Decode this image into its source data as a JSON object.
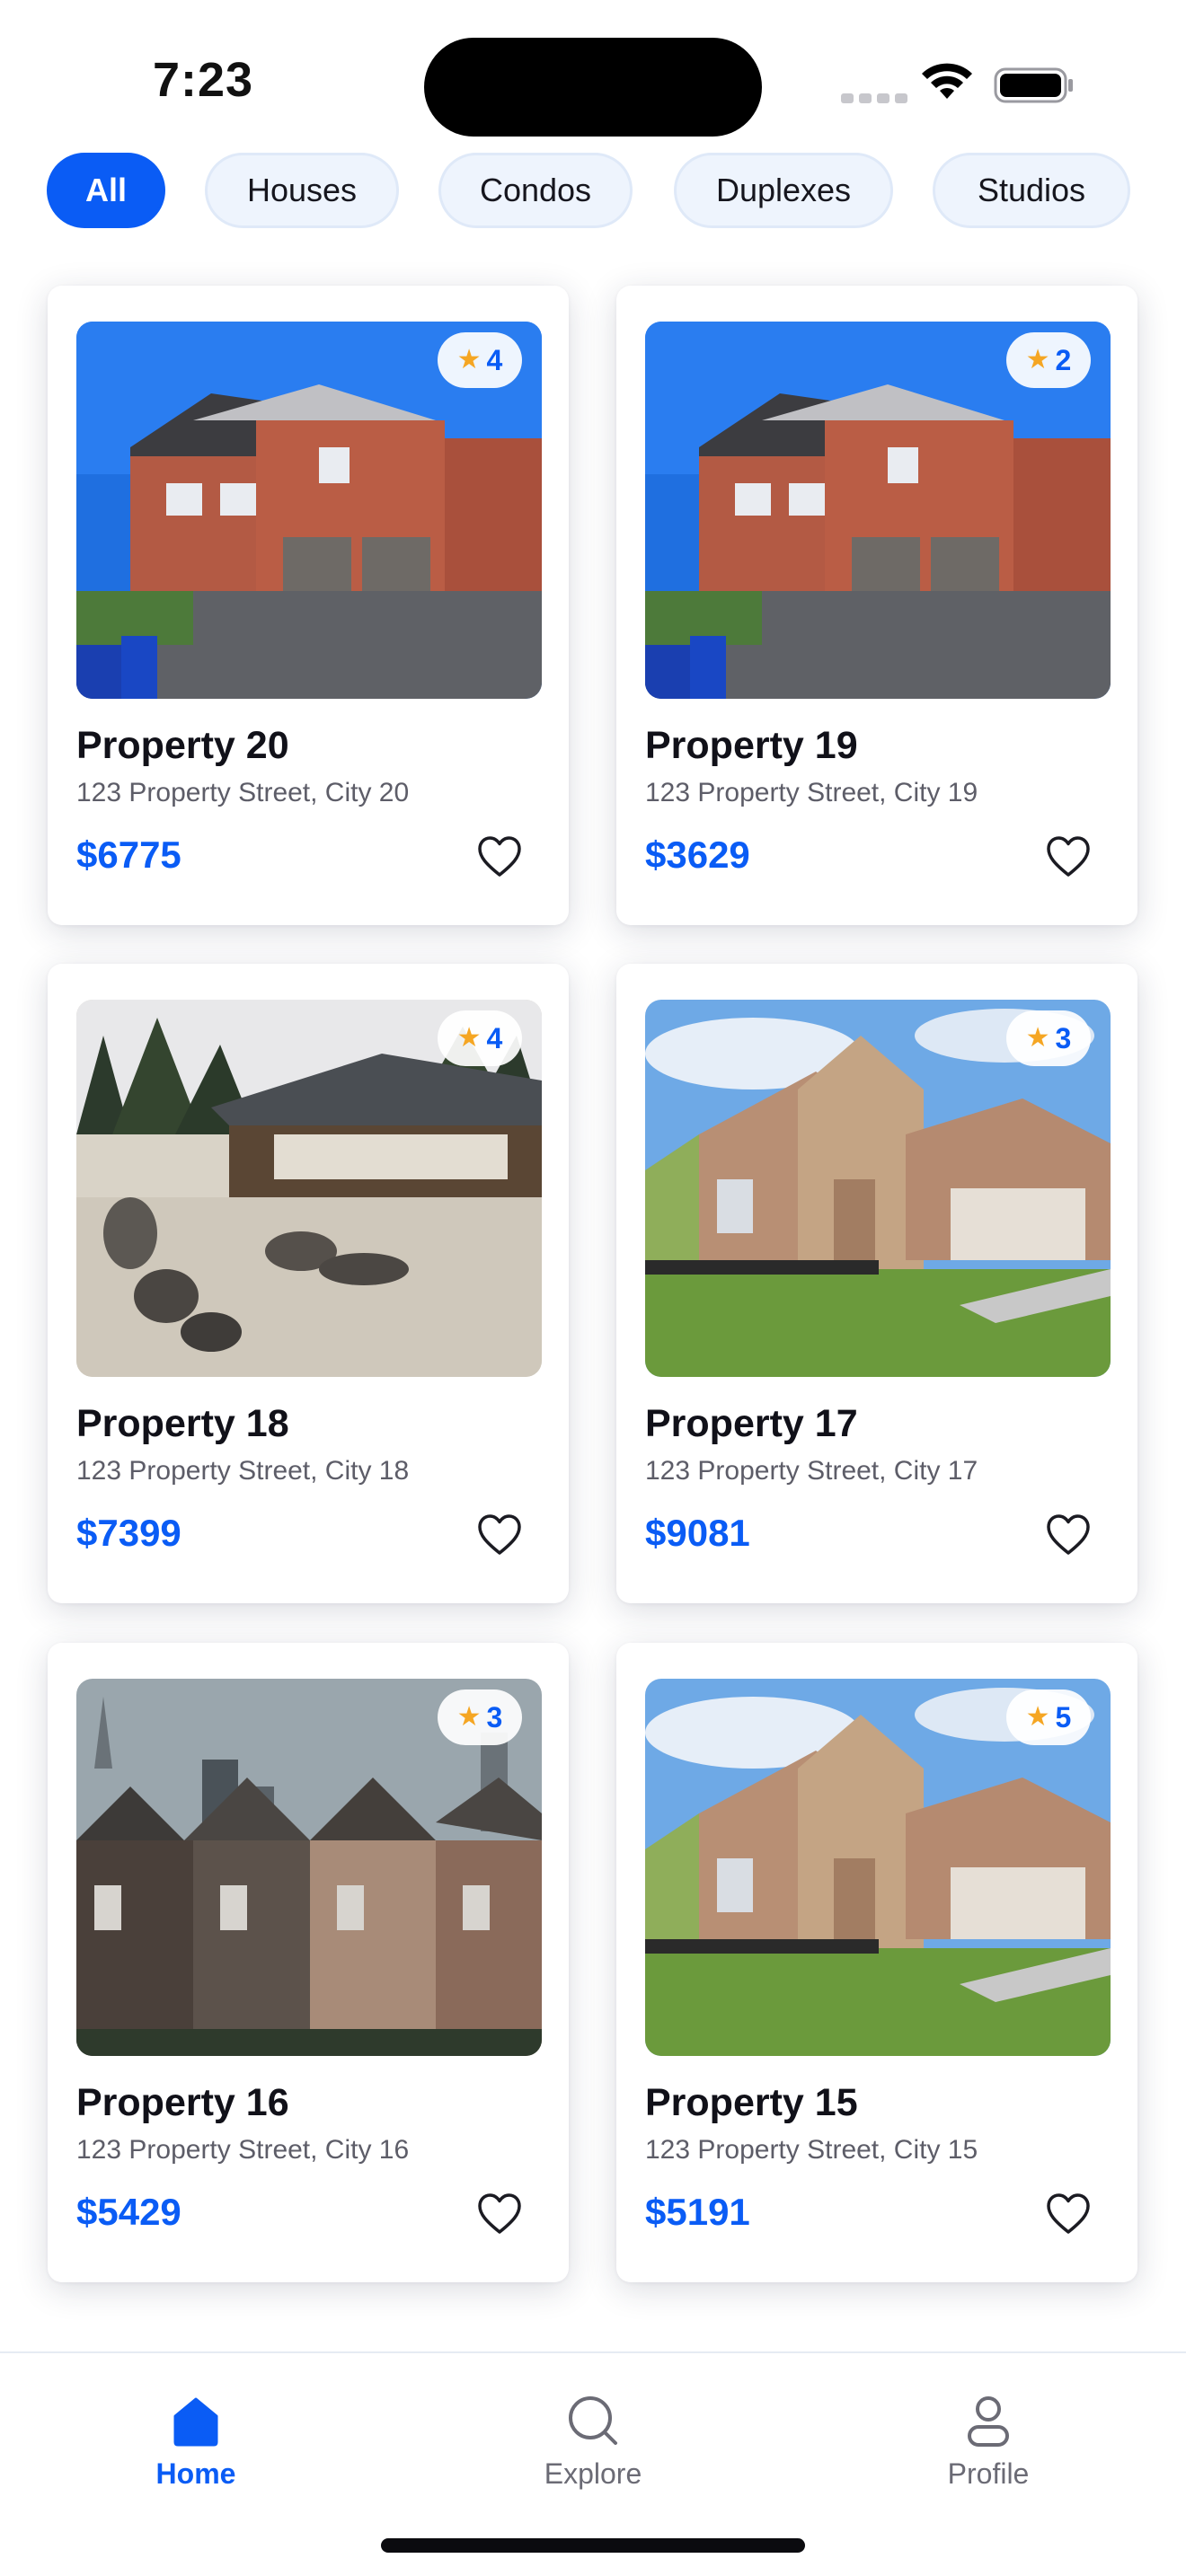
{
  "status_bar": {
    "time": "7:23"
  },
  "filters": [
    {
      "label": "All",
      "active": true
    },
    {
      "label": "Houses",
      "active": false
    },
    {
      "label": "Condos",
      "active": false
    },
    {
      "label": "Duplexes",
      "active": false
    },
    {
      "label": "Studios",
      "active": false
    }
  ],
  "properties": [
    {
      "title": "Property 20",
      "address": "123 Property Street, City 20",
      "price": "$6775",
      "rating": "4",
      "image": "brick-house-photo"
    },
    {
      "title": "Property 19",
      "address": "123 Property Street, City 19",
      "price": "$3629",
      "rating": "2",
      "image": "brick-house-photo"
    },
    {
      "title": "Property 18",
      "address": "123 Property Street, City 18",
      "price": "$7399",
      "rating": "4",
      "image": "zen-garden-pavilion-photo"
    },
    {
      "title": "Property 17",
      "address": "123 Property Street, City 17",
      "price": "$9081",
      "rating": "3",
      "image": "stone-brick-house-photo"
    },
    {
      "title": "Property 16",
      "address": "123 Property Street, City 16",
      "price": "$5429",
      "rating": "3",
      "image": "victorian-row-houses-photo"
    },
    {
      "title": "Property 15",
      "address": "123 Property Street, City 15",
      "price": "$5191",
      "rating": "5",
      "image": "stone-brick-house-photo"
    }
  ],
  "tab_bar": {
    "items": [
      {
        "label": "Home",
        "icon": "home-icon",
        "active": true
      },
      {
        "label": "Explore",
        "icon": "search-icon",
        "active": false
      },
      {
        "label": "Profile",
        "icon": "user-icon",
        "active": false
      }
    ]
  },
  "colors": {
    "accent": "#0a5cf5",
    "star": "#f5a623",
    "chip_bg": "#eef4fd"
  }
}
